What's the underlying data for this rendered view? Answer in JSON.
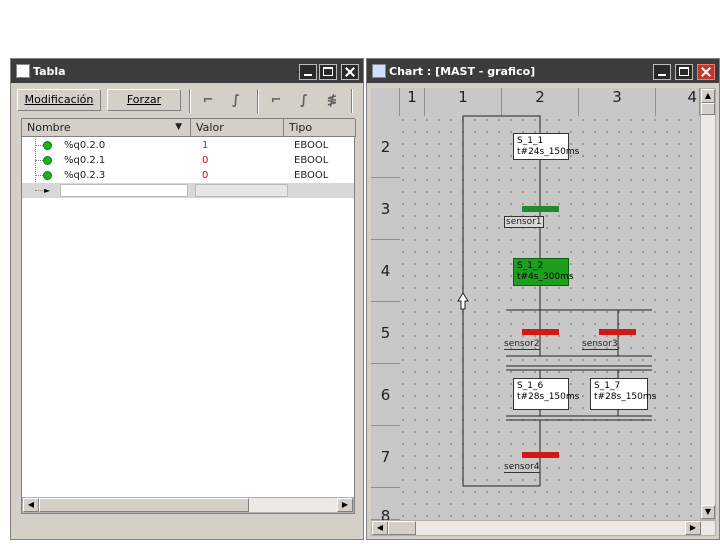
{
  "tabla": {
    "title": "Tabla",
    "toolbar": {
      "modificacion": "Modificación",
      "forzar": "Forzar"
    },
    "columns": {
      "nombre": "Nombre",
      "valor": "Valor",
      "tipo": "Tipo"
    },
    "rows": [
      {
        "name": "%q0.2.0",
        "value": "1",
        "type": "EBOOL"
      },
      {
        "name": "%q0.2.1",
        "value": "0",
        "type": "EBOOL"
      },
      {
        "name": "%q0.2.3",
        "value": "0",
        "type": "EBOOL"
      }
    ]
  },
  "chart": {
    "title": "Chart : [MAST - grafico]",
    "columns": [
      "1",
      "2",
      "3",
      "4"
    ],
    "rows": [
      "2",
      "3",
      "4",
      "5",
      "6",
      "7",
      "8"
    ],
    "steps": [
      {
        "name": "S_1_1",
        "time": "t#24s_150ms",
        "active": false
      },
      {
        "name": "S_1_2",
        "time": "t#4s_300ms",
        "active": true
      },
      {
        "name": "S_1_6",
        "time": "t#28s_150ms",
        "active": false
      },
      {
        "name": "S_1_7",
        "time": "t#28s_150ms",
        "active": false
      }
    ],
    "transitions": [
      "sensor1",
      "sensor2",
      "sensor3",
      "sensor4"
    ]
  },
  "colors": {
    "active_step": "#1e9e1e",
    "true_transition": "#1e8c2a",
    "false_transition": "#d01818"
  }
}
